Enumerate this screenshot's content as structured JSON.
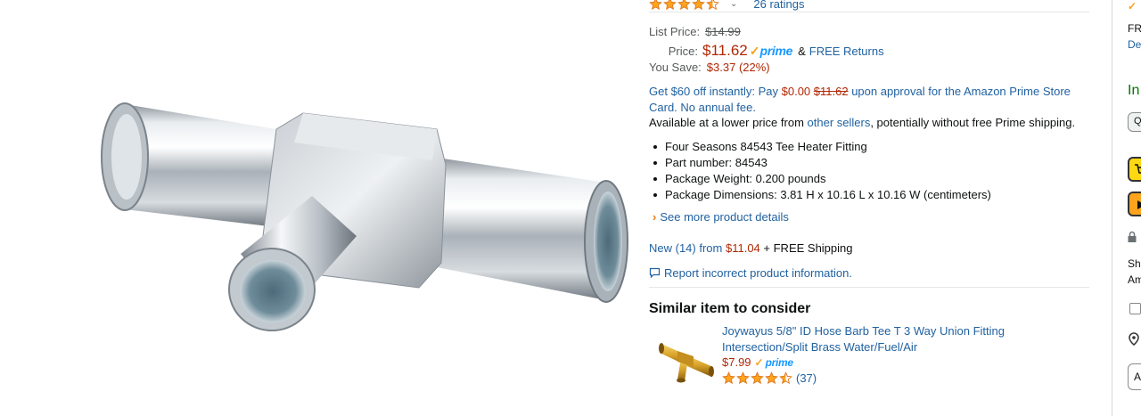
{
  "rating": {
    "stars": 4.5,
    "count_label": "26 ratings"
  },
  "price": {
    "list_label": "List Price:",
    "list_value": "$14.99",
    "price_label": "Price:",
    "price_value": "$11.62",
    "prime": "prime",
    "returns_prefix": "&",
    "returns_link": "FREE Returns",
    "save_label": "You Save:",
    "save_value": "$3.37 (22%)"
  },
  "card_offer": {
    "part1": "Get $60 off instantly: Pay ",
    "pay_amount": "$0.00",
    "struck_amount": "$11.62",
    "part2": " upon approval for the Amazon Prime Store Card. No annual fee."
  },
  "lower_price": {
    "prefix": "Available at a lower price from ",
    "link": "other sellers",
    "suffix": ", potentially without free Prime shipping."
  },
  "bullets": [
    "Four Seasons 84543 Tee Heater Fitting",
    "Part number: 84543",
    "Package Weight: 0.200 pounds",
    "Package Dimensions: 3.81 H x 10.16 L x 10.16 W (centimeters)"
  ],
  "see_more": "See more product details",
  "new_offers": {
    "link": "New (14) from",
    "price": "$11.04",
    "suffix": "+ FREE Shipping"
  },
  "report": "Report incorrect product information.",
  "similar": {
    "heading": "Similar item to consider",
    "title": "Joywayus 5/8\" ID Hose Barb Tee T 3 Way Union Fitting Intersection/Split Brass Water/Fuel/Air",
    "price": "$7.99",
    "prime": "prime",
    "stars": 4.5,
    "count": "(37)"
  },
  "buybox": {
    "line1": "FR",
    "line2": "De",
    "stock": "In",
    "qty": "Q",
    "line_sh": "Sh",
    "line_am": "Am",
    "btn_a": "A"
  },
  "colors": {
    "link": "#2162a1",
    "price": "#b12704",
    "prime_blue": "#1a98ff",
    "prime_check": "#f7a21b",
    "star": "#ffa41c",
    "in_stock": "#007600"
  }
}
